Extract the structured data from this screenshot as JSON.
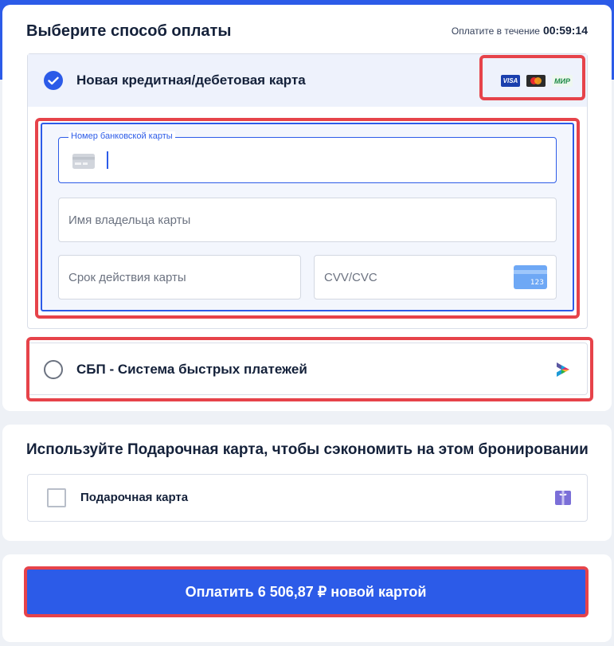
{
  "header": {
    "title": "Выберите способ оплаты",
    "timer_label": "Оплатите в течение",
    "timer_value": "00:59:14"
  },
  "card_option": {
    "label": "Новая кредитная/дебетовая карта",
    "brands": [
      "VISA",
      "MasterCard",
      "МИР"
    ],
    "selected": true
  },
  "card_form": {
    "card_number_label": "Номер банковской карты",
    "card_number_value": "",
    "holder_placeholder": "Имя владельца карты",
    "expiry_placeholder": "Срок действия карты",
    "cvv_placeholder": "CVV/CVC",
    "cvv_card_hint": "123"
  },
  "sbp_option": {
    "label": "СБП - Система быстрых платежей",
    "selected": false
  },
  "gift": {
    "title": "Используйте Подарочная карта, чтобы сэкономить на этом бронировании",
    "checkbox_label": "Подарочная карта",
    "checked": false
  },
  "pay_button": {
    "label": "Оплатить 6 506,87 ₽ новой картой"
  },
  "colors": {
    "accent": "#2c5be8",
    "highlight": "#e6434a",
    "background": "#eef1f6"
  }
}
